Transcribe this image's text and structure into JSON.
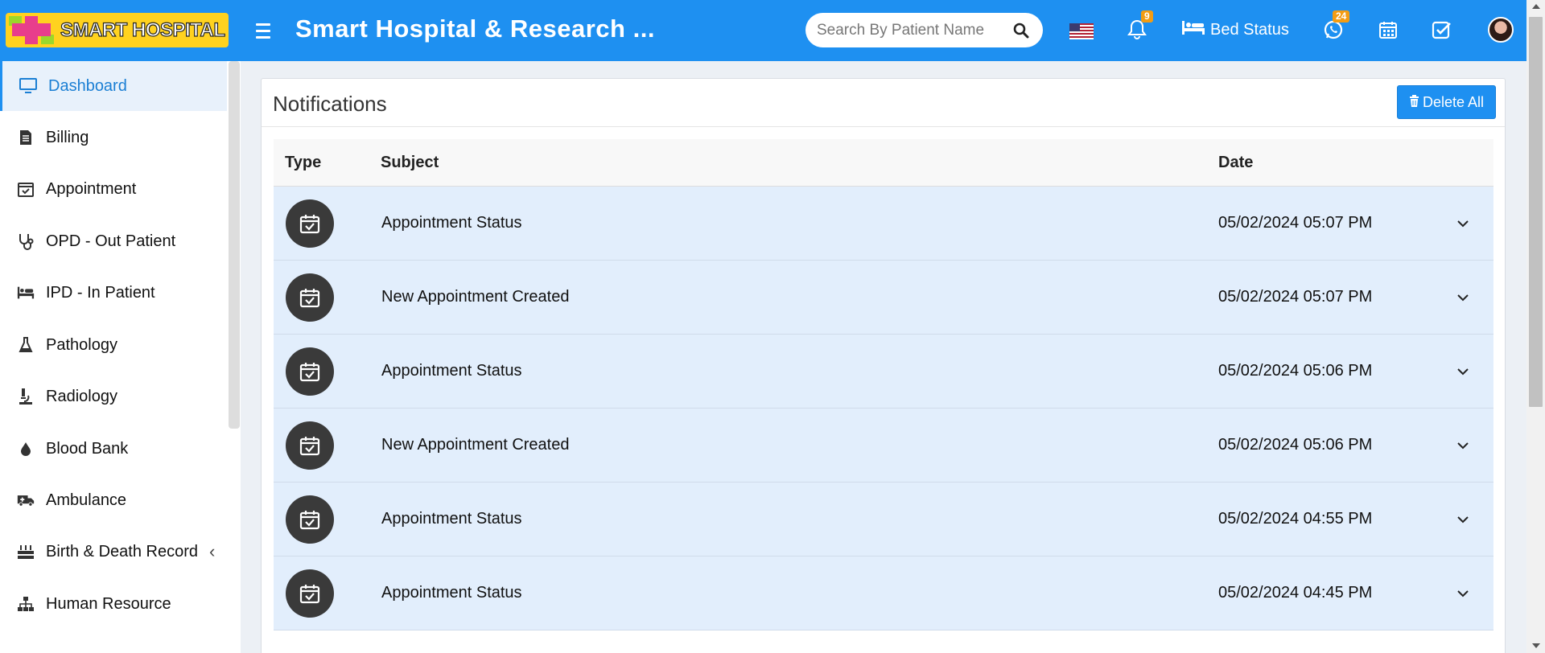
{
  "header": {
    "logo_text": "SMART HOSPITAL",
    "title": "Smart Hospital & Research ...",
    "search_placeholder": "Search By Patient Name",
    "notifications_count": "9",
    "bed_status_label": "Bed Status",
    "whatsapp_count": "24",
    "accent_color": "#1e90f1"
  },
  "sidebar": {
    "items": [
      {
        "label": "Dashboard",
        "icon": "monitor-icon"
      },
      {
        "label": "Billing",
        "icon": "bill-icon"
      },
      {
        "label": "Appointment",
        "icon": "calendar-check-icon"
      },
      {
        "label": "OPD - Out Patient",
        "icon": "stethoscope-icon"
      },
      {
        "label": "IPD - In Patient",
        "icon": "bed-icon"
      },
      {
        "label": "Pathology",
        "icon": "flask-icon"
      },
      {
        "label": "Radiology",
        "icon": "microscope-icon"
      },
      {
        "label": "Blood Bank",
        "icon": "blood-drop-icon"
      },
      {
        "label": "Ambulance",
        "icon": "ambulance-icon"
      },
      {
        "label": "Birth & Death Record",
        "icon": "birthday-cake-icon"
      },
      {
        "label": "Human Resource",
        "icon": "sitemap-icon"
      }
    ]
  },
  "main": {
    "title": "Notifications",
    "delete_all_label": "Delete All",
    "columns": {
      "type": "Type",
      "subject": "Subject",
      "date": "Date"
    },
    "rows": [
      {
        "subject": "Appointment Status",
        "date": "05/02/2024 05:07 PM"
      },
      {
        "subject": "New Appointment Created",
        "date": "05/02/2024 05:07 PM"
      },
      {
        "subject": "Appointment Status",
        "date": "05/02/2024 05:06 PM"
      },
      {
        "subject": "New Appointment Created",
        "date": "05/02/2024 05:06 PM"
      },
      {
        "subject": "Appointment Status",
        "date": "05/02/2024 04:55 PM"
      },
      {
        "subject": "Appointment Status",
        "date": "05/02/2024 04:45 PM"
      }
    ]
  }
}
